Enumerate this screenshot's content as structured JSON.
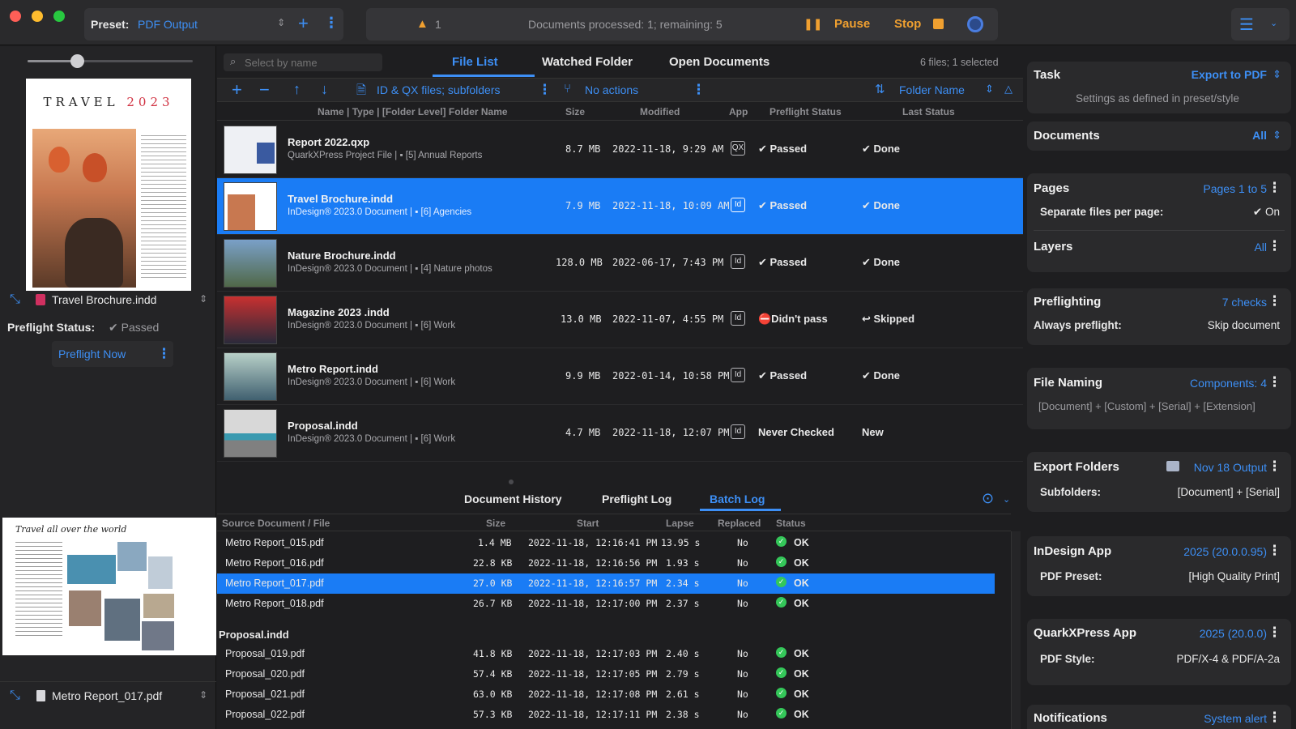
{
  "titlebar": {
    "preset_label": "Preset:",
    "preset_value": "PDF Output",
    "warning_count": "1",
    "status_text": "Documents processed: 1; remaining: 5",
    "pause_label": "Pause",
    "stop_label": "Stop"
  },
  "left": {
    "preview_title_main": "TRAVEL",
    "preview_title_year": "2023",
    "doc_name": "Travel Brochure.indd",
    "preflight_status_label": "Preflight Status:",
    "preflight_status_value": "✔ Passed",
    "preflight_now_label": "Preflight Now",
    "preview2_heading": "Travel all over the world",
    "bottom_doc_name": "Metro Report_017.pdf"
  },
  "filelist": {
    "search_placeholder": "Select by name",
    "tabs": [
      "File List",
      "Watched Folder",
      "Open Documents"
    ],
    "active_tab": 0,
    "summary": "6 files; 1 selected",
    "toolbar": {
      "filter_label": "ID & QX files; subfolders",
      "actions_label": "No actions",
      "sort_label": "Folder Name"
    },
    "columns": [
      "Name | Type | [Folder Level] Folder Name",
      "Size",
      "Modified",
      "App",
      "Preflight Status",
      "Last Status"
    ],
    "rows": [
      {
        "name": "Report 2022.qxp",
        "sub": "QuarkXPress Project File",
        "folder": "[5] Annual Reports",
        "size": "8.7 MB",
        "modified": "2022-11-18, 9:29 AM",
        "app": "QX",
        "preflight": "✔ Passed",
        "last": "✔ Done",
        "selected": false
      },
      {
        "name": "Travel Brochure.indd",
        "sub": "InDesign® 2023.0 Document",
        "folder": "[6] Agencies",
        "size": "7.9 MB",
        "modified": "2022-11-18, 10:09 AM",
        "app": "Id",
        "preflight": "✔ Passed",
        "last": "✔ Done",
        "selected": true
      },
      {
        "name": "Nature Brochure.indd",
        "sub": "InDesign® 2023.0 Document",
        "folder": "[4] Nature photos",
        "size": "128.0 MB",
        "modified": "2022-06-17, 7:43 PM",
        "app": "Id",
        "preflight": "✔ Passed",
        "last": "✔ Done",
        "selected": false
      },
      {
        "name": "Magazine 2023 .indd",
        "sub": "InDesign® 2023.0 Document",
        "folder": "[6] Work",
        "size": "13.0 MB",
        "modified": "2022-11-07, 4:55 PM",
        "app": "Id",
        "preflight": "⛔Didn't pass",
        "last": "↩ Skipped",
        "selected": false
      },
      {
        "name": "Metro Report.indd",
        "sub": "InDesign® 2023.0 Document",
        "folder": "[6] Work",
        "size": "9.9 MB",
        "modified": "2022-01-14, 10:58 PM",
        "app": "Id",
        "preflight": "✔ Passed",
        "last": "✔ Done",
        "selected": false
      },
      {
        "name": "Proposal.indd",
        "sub": "InDesign® 2023.0 Document",
        "folder": "[6] Work",
        "size": "4.7 MB",
        "modified": "2022-11-18, 12:07 PM",
        "app": "Id",
        "preflight": "Never Checked",
        "last": "New",
        "selected": false
      }
    ]
  },
  "log": {
    "tabs": [
      "Document History",
      "Preflight Log",
      "Batch Log"
    ],
    "active_tab": 2,
    "columns": [
      "Source Document / File",
      "Size",
      "Start",
      "Lapse",
      "Replaced",
      "Status"
    ],
    "rows": [
      {
        "file": "Metro Report_015.pdf",
        "size": "1.4 MB",
        "start": "2022-11-18, 12:16:41 PM",
        "lapse": "13.95 s",
        "replaced": "No",
        "status": "OK"
      },
      {
        "file": "Metro Report_016.pdf",
        "size": "22.8 KB",
        "start": "2022-11-18, 12:16:56 PM",
        "lapse": "1.93 s",
        "replaced": "No",
        "status": "OK"
      },
      {
        "file": "Metro Report_017.pdf",
        "size": "27.0 KB",
        "start": "2022-11-18, 12:16:57 PM",
        "lapse": "2.34 s",
        "replaced": "No",
        "status": "OK",
        "selected": true
      },
      {
        "file": "Metro Report_018.pdf",
        "size": "26.7 KB",
        "start": "2022-11-18, 12:17:00 PM",
        "lapse": "2.37 s",
        "replaced": "No",
        "status": "OK"
      }
    ],
    "group2_label": "Proposal.indd",
    "rows2": [
      {
        "file": "Proposal_019.pdf",
        "size": "41.8 KB",
        "start": "2022-11-18, 12:17:03 PM",
        "lapse": "2.40 s",
        "replaced": "No",
        "status": "OK"
      },
      {
        "file": "Proposal_020.pdf",
        "size": "57.4 KB",
        "start": "2022-11-18, 12:17:05 PM",
        "lapse": "2.79 s",
        "replaced": "No",
        "status": "OK"
      },
      {
        "file": "Proposal_021.pdf",
        "size": "63.0 KB",
        "start": "2022-11-18, 12:17:08 PM",
        "lapse": "2.61 s",
        "replaced": "No",
        "status": "OK"
      },
      {
        "file": "Proposal_022.pdf",
        "size": "57.3 KB",
        "start": "2022-11-18, 12:17:11 PM",
        "lapse": "2.38 s",
        "replaced": "No",
        "status": "OK"
      }
    ]
  },
  "settings": {
    "task_label": "Task",
    "task_value": "Export to PDF",
    "task_note": "Settings as defined in preset/style",
    "documents_label": "Documents",
    "documents_value": "All",
    "pages_label": "Pages",
    "pages_value": "Pages 1 to 5",
    "separate_label": "Separate files per page:",
    "separate_value": "✔ On",
    "layers_label": "Layers",
    "layers_value": "All",
    "preflighting_label": "Preflighting",
    "preflighting_value": "7 checks",
    "always_label": "Always preflight:",
    "always_value": "Skip document",
    "naming_label": "File Naming",
    "naming_value": "Components: 4",
    "naming_note": "[Document] + [Custom] + [Serial] + [Extension]",
    "folders_label": "Export Folders",
    "folders_value": "Nov 18 Output",
    "subfolders_label": "Subfolders:",
    "subfolders_value": "[Document] + [Serial]",
    "indesign_label": "InDesign App",
    "indesign_value": "2025 (20.0.0.95)",
    "pdfpreset_label": "PDF Preset:",
    "pdfpreset_value": "[High Quality Print]",
    "quark_label": "QuarkXPress App",
    "quark_value": "2025 (20.0.0)",
    "pdfstyle_label": "PDF Style:",
    "pdfstyle_value": "PDF/X-4 & PDF/A-2a",
    "notif_label": "Notifications",
    "notif_value": "System alert"
  },
  "colors": {
    "accent": "#1a7cf5",
    "link": "#3d8ff5",
    "warning": "#f0a030",
    "ok": "#34c759",
    "close": "#ff5f57",
    "minimize": "#febc2e",
    "zoom": "#28c840"
  }
}
